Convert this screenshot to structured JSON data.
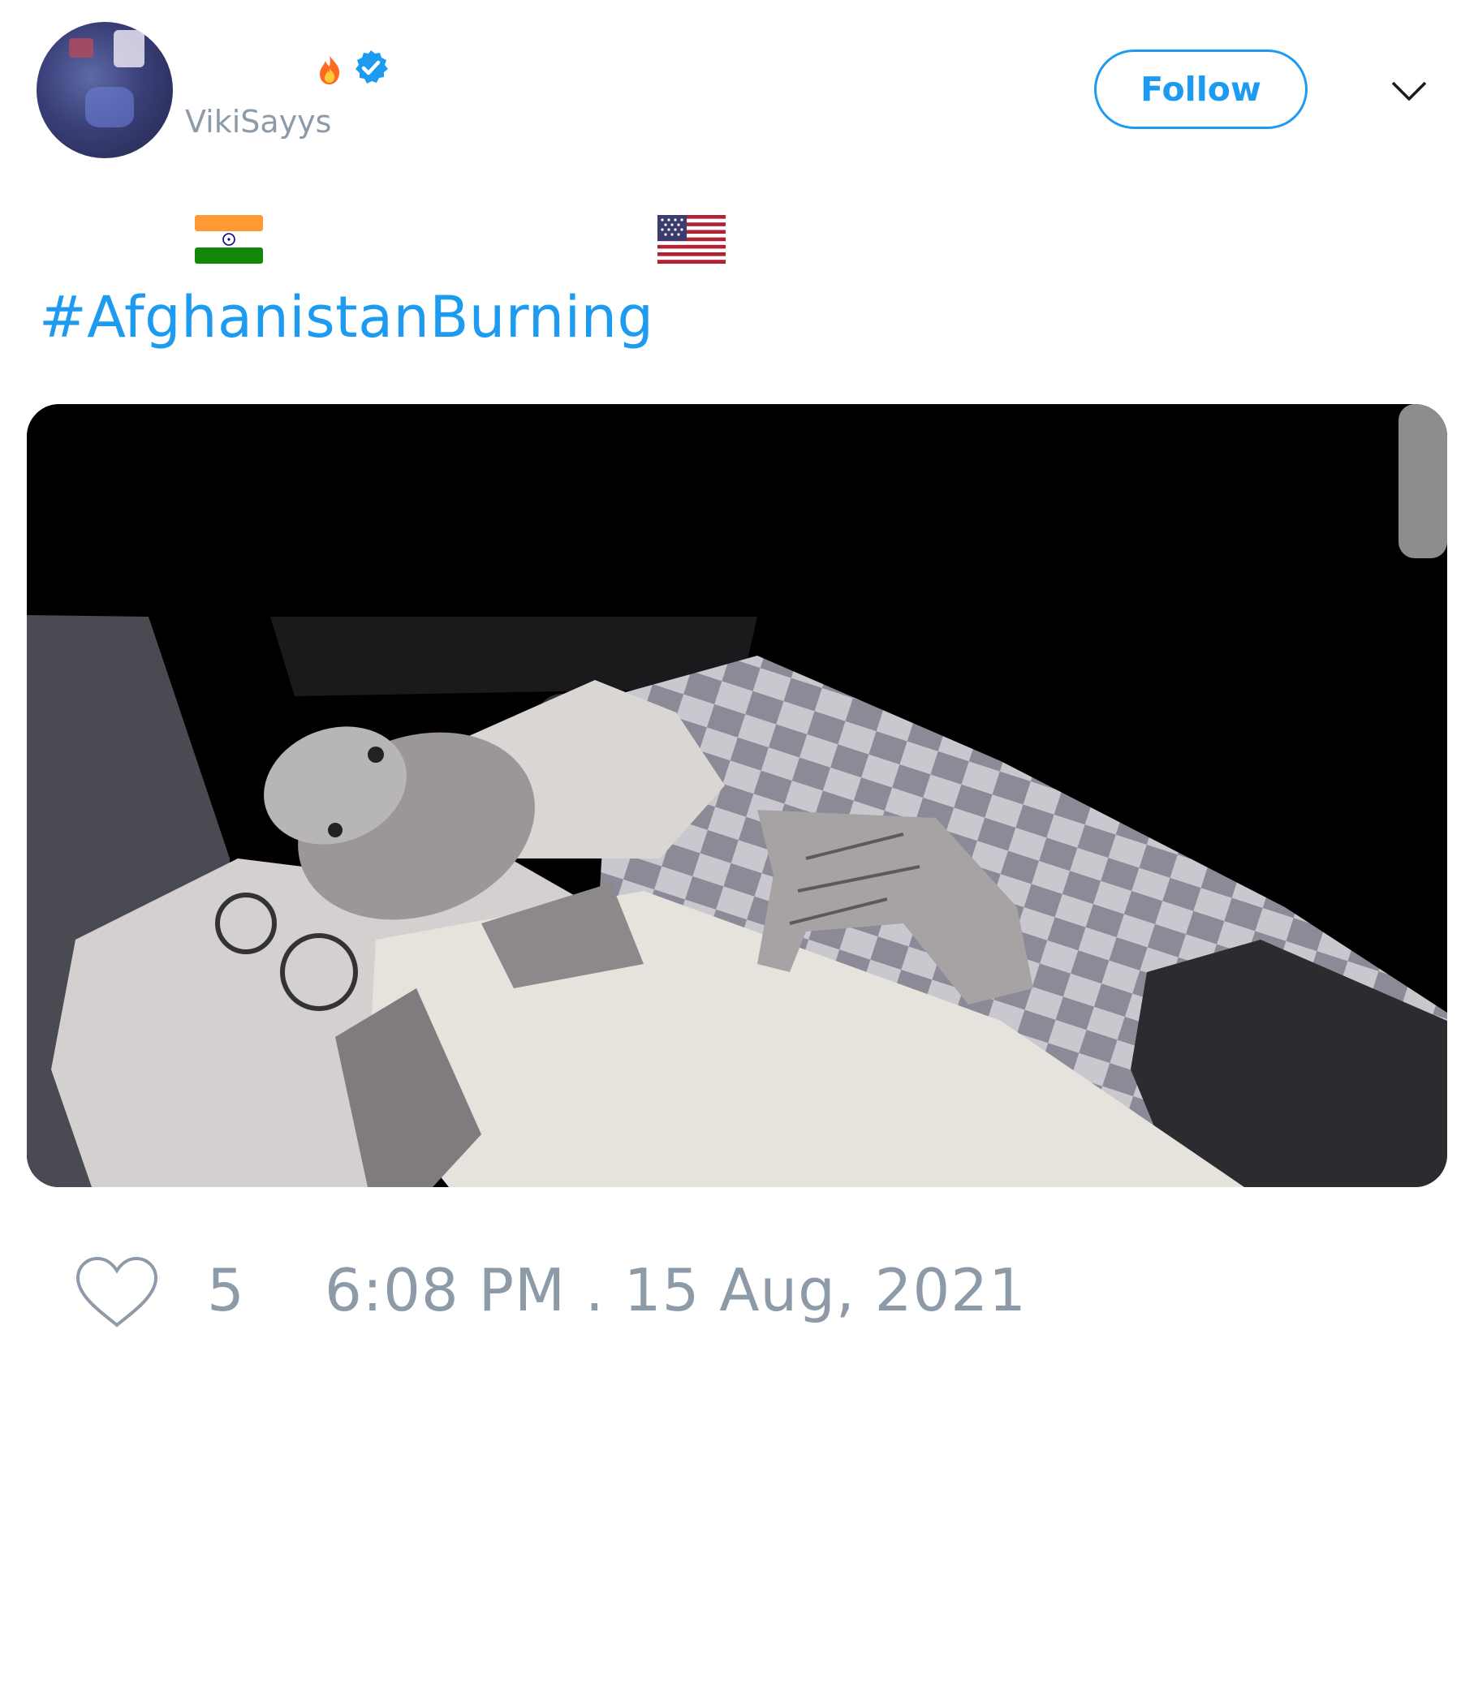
{
  "header": {
    "avatar_icon": "profile-avatar",
    "handle": "VikiSayys",
    "badges": [
      "fire-emoji",
      "verified-badge-icon"
    ],
    "verified_color": "#1d9bf0",
    "follow_label": "Follow",
    "menu_icon": "chevron-down-icon"
  },
  "tweet": {
    "flags": [
      "india-flag-emoji",
      "usa-flag-emoji"
    ],
    "hashtag": "#AfghanistanBurning",
    "media_icon": "photo-man-lying-on-bed"
  },
  "footer": {
    "like_icon": "heart-outline-icon",
    "like_count": "5",
    "timestamp": "6:08 PM . 15 Aug, 2021"
  },
  "colors": {
    "accent": "#1d9bf0",
    "muted": "#8d9aa8",
    "background": "#ffffff"
  }
}
